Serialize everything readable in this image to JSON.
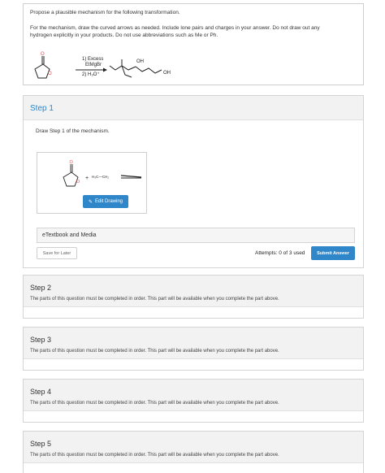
{
  "question": {
    "line1": "Propose a plausible mechanism for the following transformation.",
    "line2": "For the mechanism, draw the curved arrows as needed. Include lone pairs and charges in your answer. Do not draw out any",
    "line3": "hydrogen explicitly in your products. Do not use abbreviations such as Me or Ph.",
    "reaction": {
      "reagent1": "1) Excess",
      "reagent2": "EtMgBr",
      "reagent3": "2) H₃O⁺",
      "oh_top": "OH",
      "oh_right": "OH"
    }
  },
  "step1": {
    "title": "Step 1",
    "instruction": "Draw Step 1 of the mechanism.",
    "drawing_reagent": "H₃C—CH₂",
    "edit_label": "Edit Drawing",
    "etext_label": "eTextbook and Media",
    "save_label": "Save for Later",
    "attempts_label": "Attempts: 0 of 3 used",
    "submit_label": "Submit Answer"
  },
  "locked_message": "The parts of this question must be completed in order. This part will be available when you complete the part above.",
  "steps": [
    {
      "title": "Step 2",
      "message": "The parts of this question must be completed in order. This part will be available when you complete the part above."
    },
    {
      "title": "Step 3",
      "message": "The parts of this question must be completed in order. This part will be available when you complete the part above."
    },
    {
      "title": "Step 4",
      "message": "The parts of this question must be completed in order. This part will be available when you complete the part above."
    },
    {
      "title": "Step 5",
      "message": "The parts of this question must be completed in order. This part will be available when you complete the part above."
    }
  ],
  "colors": {
    "accent": "#2f86c9",
    "oxygen": "#d9534f"
  }
}
